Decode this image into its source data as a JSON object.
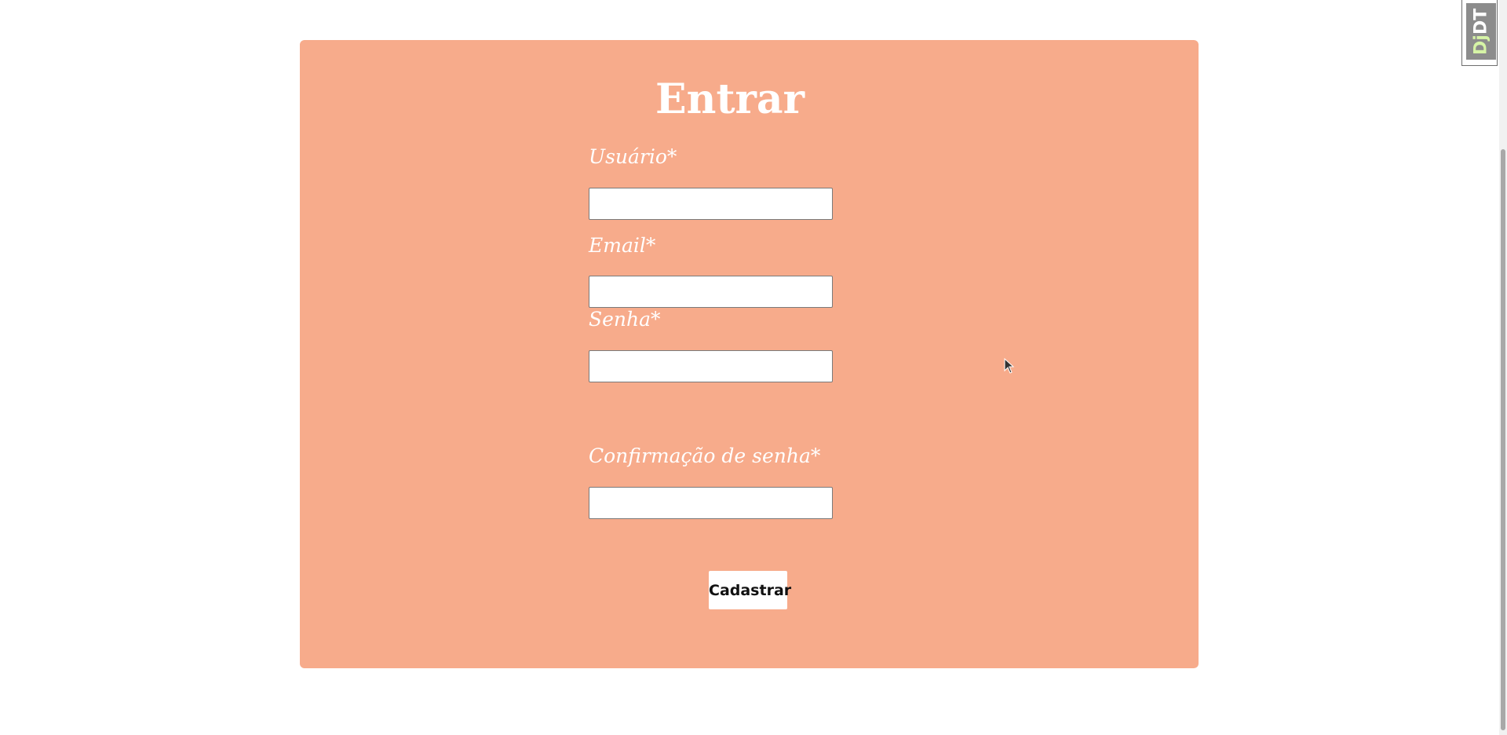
{
  "form": {
    "title": "Entrar",
    "fields": [
      {
        "label": "Usuário*",
        "value": "",
        "type": "text"
      },
      {
        "label": "Email*",
        "value": "",
        "type": "email"
      },
      {
        "label": "Senha*",
        "value": "",
        "type": "password"
      },
      {
        "label": "Confirmação de senha*",
        "value": "",
        "type": "password"
      }
    ],
    "submit_label": "Cadastrar"
  },
  "debug_toolbar": {
    "handle_label_prefix": "Dj",
    "handle_label_suffix": "DT"
  },
  "colors": {
    "card_background": "#f7ab8b",
    "text_on_card": "#ffffff",
    "page_background": "#ffffff"
  }
}
